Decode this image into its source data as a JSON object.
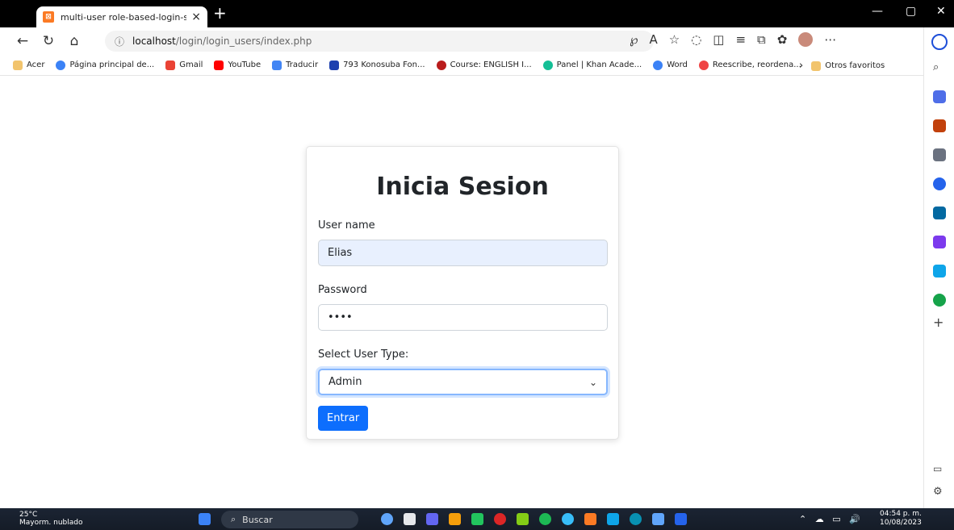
{
  "browser": {
    "tab_title": "multi-user role-based-login-syste",
    "tab_close": "×",
    "new_tab": "+",
    "window_controls": {
      "minimize": "—",
      "restore": "▢",
      "close": "✕"
    },
    "url_host": "localhost",
    "url_path": "/login/login_users/index.php",
    "bookmarks": [
      "Acer",
      "Página principal de...",
      "Gmail",
      "YouTube",
      "Traducir",
      "793 Konosuba Fon...",
      "Course: ENGLISH I...",
      "Panel | Khan Acade...",
      "Word",
      "Reescribe, reordena..."
    ],
    "bookmarks_more": "›",
    "other_favorites": "Otros favoritos"
  },
  "login": {
    "title": "Inicia Sesion",
    "username_label": "User name",
    "username_value": "Elias",
    "password_label": "Password",
    "password_value": "••••",
    "usertype_label": "Select User Type:",
    "usertype_selected": "Admin",
    "submit_label": "Entrar"
  },
  "taskbar": {
    "temperature": "25°C",
    "weather_desc": "Mayorm. nublado",
    "search_placeholder": "Buscar",
    "time": "04:54 p. m.",
    "date": "10/08/2023"
  },
  "colors": {
    "primary": "#0d6efd",
    "focus_border": "#86b7fe",
    "autofill_bg": "#e8f0fe"
  }
}
